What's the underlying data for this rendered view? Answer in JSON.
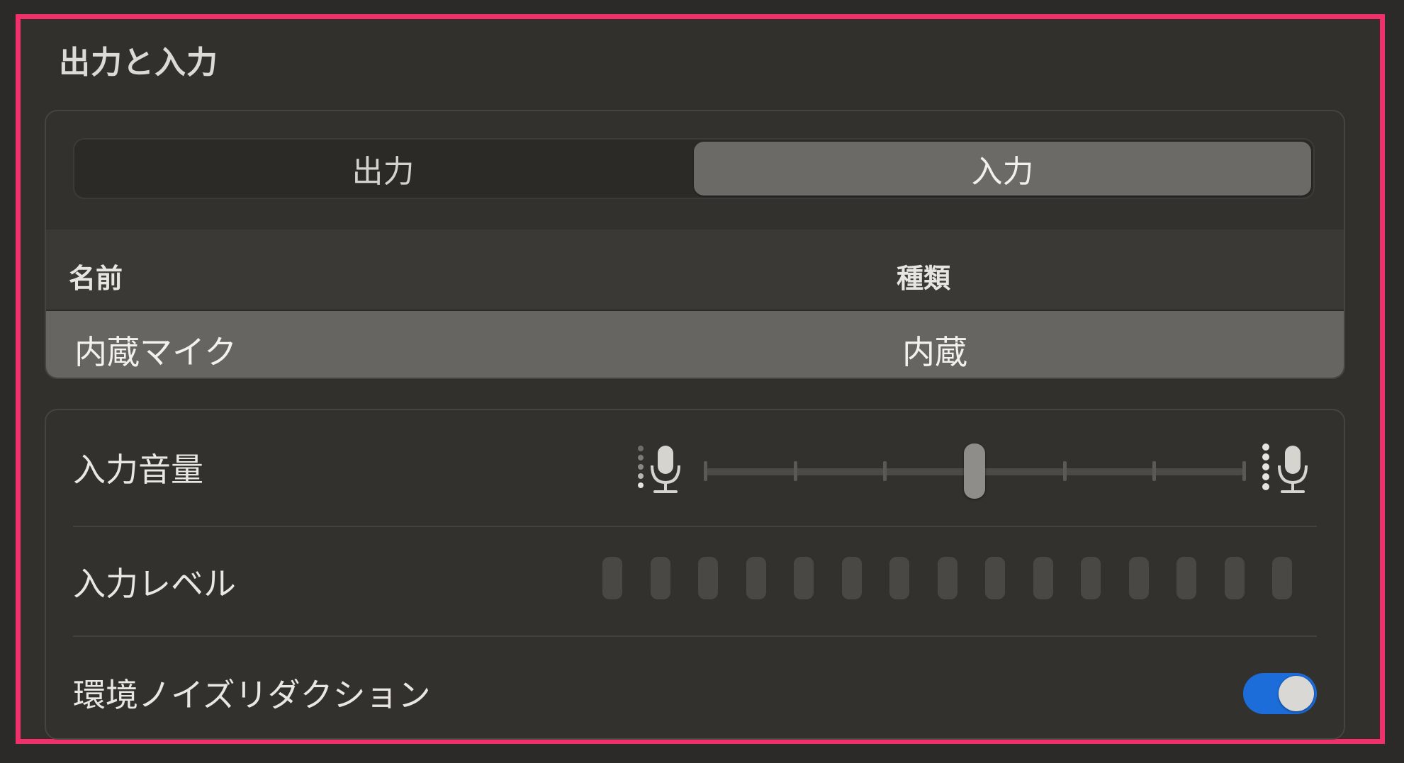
{
  "section": {
    "title": "出力と入力"
  },
  "tabs": [
    {
      "label": "出力",
      "selected": false
    },
    {
      "label": "入力",
      "selected": true
    }
  ],
  "device_table": {
    "columns": [
      "名前",
      "種類"
    ],
    "rows": [
      {
        "name": "内蔵マイク",
        "type": "内蔵",
        "selected": true
      }
    ]
  },
  "input_volume": {
    "label": "入力音量",
    "value": 0.5,
    "tick_count": 7,
    "min_icon": "microphone-low-icon",
    "max_icon": "microphone-high-icon"
  },
  "input_level": {
    "label": "入力レベル",
    "segment_count": 15,
    "active_segments": 0
  },
  "noise_reduction": {
    "label": "環境ノイズリダクション",
    "enabled": true
  },
  "colors": {
    "highlight_border": "#f0306b",
    "toggle_on": "#1c6cd9",
    "selected_row": "#676562"
  }
}
